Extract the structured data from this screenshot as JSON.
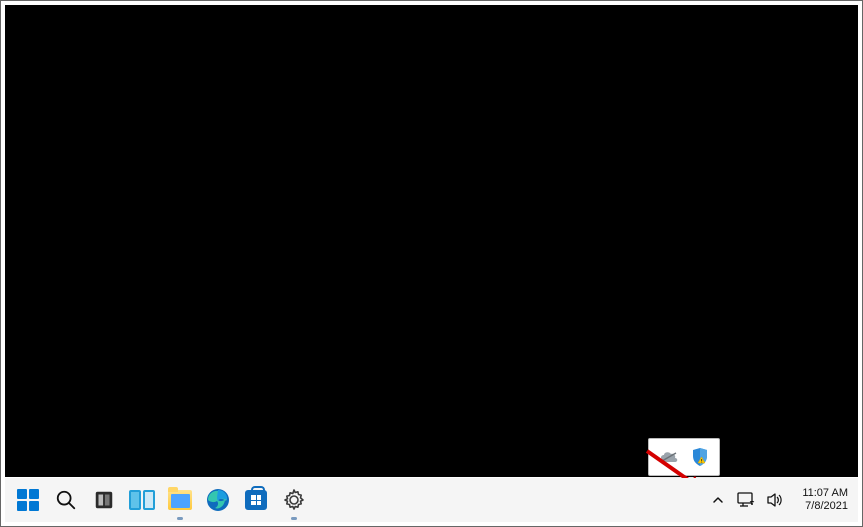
{
  "taskbar": {
    "start": "Start",
    "search": "Search",
    "copilot": "Copilot",
    "task_view": "Task view",
    "file_explorer": "File Explorer",
    "edge": "Microsoft Edge",
    "store": "Microsoft Store",
    "settings": "Settings"
  },
  "systray": {
    "show_hidden": "Show hidden icons",
    "network": "Network",
    "volume": "Volume",
    "time": "11:07 AM",
    "date": "7/8/2021"
  },
  "overflow": {
    "onedrive": "OneDrive",
    "security": "Windows Security"
  },
  "annotation": {
    "arrow": "Red arrow pointing to Show hidden icons"
  }
}
